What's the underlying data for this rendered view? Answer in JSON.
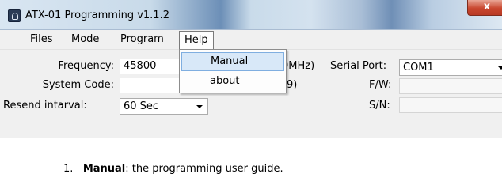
{
  "window": {
    "title": "ATX-01 Programming v1.1.2",
    "close_label": "x"
  },
  "menubar": {
    "items": [
      "Files",
      "Mode",
      "Program",
      "Help"
    ]
  },
  "help_menu": {
    "items": [
      "Manual",
      "about"
    ],
    "highlighted": "Manual"
  },
  "form": {
    "frequency_label": "Frequency:",
    "frequency_value": "45800",
    "frequency_hint_fragment": "0MHz)",
    "system_code_label": "System Code:",
    "system_code_value": "",
    "system_code_hint_fragment": "9)",
    "resend_label": "Resend intarval:",
    "resend_value": "60 Sec",
    "serial_port_label": "Serial Port:",
    "serial_port_value": "COM1",
    "fw_label": "F/W:",
    "sn_label": "S/N:"
  },
  "doc": {
    "number": "1.",
    "term": "Manual",
    "text": ": the programming user guide."
  }
}
